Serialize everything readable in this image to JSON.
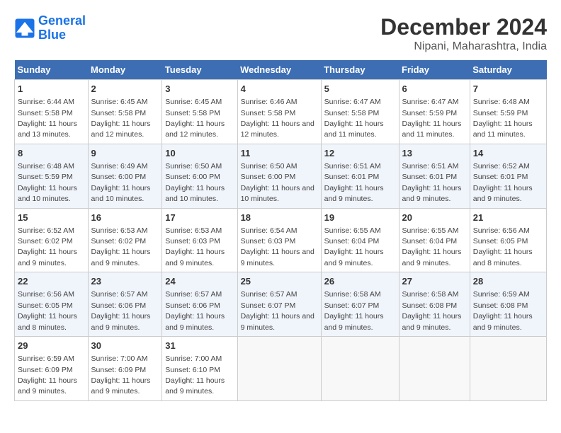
{
  "logo": {
    "line1": "General",
    "line2": "Blue"
  },
  "title": "December 2024",
  "subtitle": "Nipani, Maharashtra, India",
  "weekdays": [
    "Sunday",
    "Monday",
    "Tuesday",
    "Wednesday",
    "Thursday",
    "Friday",
    "Saturday"
  ],
  "weeks": [
    [
      {
        "day": 1,
        "sunrise": "6:44 AM",
        "sunset": "5:58 PM",
        "daylight": "11 hours and 13 minutes."
      },
      {
        "day": 2,
        "sunrise": "6:45 AM",
        "sunset": "5:58 PM",
        "daylight": "11 hours and 12 minutes."
      },
      {
        "day": 3,
        "sunrise": "6:45 AM",
        "sunset": "5:58 PM",
        "daylight": "11 hours and 12 minutes."
      },
      {
        "day": 4,
        "sunrise": "6:46 AM",
        "sunset": "5:58 PM",
        "daylight": "11 hours and 12 minutes."
      },
      {
        "day": 5,
        "sunrise": "6:47 AM",
        "sunset": "5:58 PM",
        "daylight": "11 hours and 11 minutes."
      },
      {
        "day": 6,
        "sunrise": "6:47 AM",
        "sunset": "5:59 PM",
        "daylight": "11 hours and 11 minutes."
      },
      {
        "day": 7,
        "sunrise": "6:48 AM",
        "sunset": "5:59 PM",
        "daylight": "11 hours and 11 minutes."
      }
    ],
    [
      {
        "day": 8,
        "sunrise": "6:48 AM",
        "sunset": "5:59 PM",
        "daylight": "11 hours and 10 minutes."
      },
      {
        "day": 9,
        "sunrise": "6:49 AM",
        "sunset": "6:00 PM",
        "daylight": "11 hours and 10 minutes."
      },
      {
        "day": 10,
        "sunrise": "6:50 AM",
        "sunset": "6:00 PM",
        "daylight": "11 hours and 10 minutes."
      },
      {
        "day": 11,
        "sunrise": "6:50 AM",
        "sunset": "6:00 PM",
        "daylight": "11 hours and 10 minutes."
      },
      {
        "day": 12,
        "sunrise": "6:51 AM",
        "sunset": "6:01 PM",
        "daylight": "11 hours and 9 minutes."
      },
      {
        "day": 13,
        "sunrise": "6:51 AM",
        "sunset": "6:01 PM",
        "daylight": "11 hours and 9 minutes."
      },
      {
        "day": 14,
        "sunrise": "6:52 AM",
        "sunset": "6:01 PM",
        "daylight": "11 hours and 9 minutes."
      }
    ],
    [
      {
        "day": 15,
        "sunrise": "6:52 AM",
        "sunset": "6:02 PM",
        "daylight": "11 hours and 9 minutes."
      },
      {
        "day": 16,
        "sunrise": "6:53 AM",
        "sunset": "6:02 PM",
        "daylight": "11 hours and 9 minutes."
      },
      {
        "day": 17,
        "sunrise": "6:53 AM",
        "sunset": "6:03 PM",
        "daylight": "11 hours and 9 minutes."
      },
      {
        "day": 18,
        "sunrise": "6:54 AM",
        "sunset": "6:03 PM",
        "daylight": "11 hours and 9 minutes."
      },
      {
        "day": 19,
        "sunrise": "6:55 AM",
        "sunset": "6:04 PM",
        "daylight": "11 hours and 9 minutes."
      },
      {
        "day": 20,
        "sunrise": "6:55 AM",
        "sunset": "6:04 PM",
        "daylight": "11 hours and 9 minutes."
      },
      {
        "day": 21,
        "sunrise": "6:56 AM",
        "sunset": "6:05 PM",
        "daylight": "11 hours and 8 minutes."
      }
    ],
    [
      {
        "day": 22,
        "sunrise": "6:56 AM",
        "sunset": "6:05 PM",
        "daylight": "11 hours and 8 minutes."
      },
      {
        "day": 23,
        "sunrise": "6:57 AM",
        "sunset": "6:06 PM",
        "daylight": "11 hours and 9 minutes."
      },
      {
        "day": 24,
        "sunrise": "6:57 AM",
        "sunset": "6:06 PM",
        "daylight": "11 hours and 9 minutes."
      },
      {
        "day": 25,
        "sunrise": "6:57 AM",
        "sunset": "6:07 PM",
        "daylight": "11 hours and 9 minutes."
      },
      {
        "day": 26,
        "sunrise": "6:58 AM",
        "sunset": "6:07 PM",
        "daylight": "11 hours and 9 minutes."
      },
      {
        "day": 27,
        "sunrise": "6:58 AM",
        "sunset": "6:08 PM",
        "daylight": "11 hours and 9 minutes."
      },
      {
        "day": 28,
        "sunrise": "6:59 AM",
        "sunset": "6:08 PM",
        "daylight": "11 hours and 9 minutes."
      }
    ],
    [
      {
        "day": 29,
        "sunrise": "6:59 AM",
        "sunset": "6:09 PM",
        "daylight": "11 hours and 9 minutes."
      },
      {
        "day": 30,
        "sunrise": "7:00 AM",
        "sunset": "6:09 PM",
        "daylight": "11 hours and 9 minutes."
      },
      {
        "day": 31,
        "sunrise": "7:00 AM",
        "sunset": "6:10 PM",
        "daylight": "11 hours and 9 minutes."
      },
      null,
      null,
      null,
      null
    ]
  ]
}
